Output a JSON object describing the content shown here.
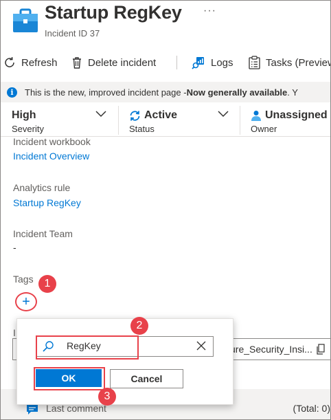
{
  "header": {
    "title": "Startup RegKey",
    "more": "···",
    "subtitle": "Incident ID 37"
  },
  "toolbar": {
    "refresh": "Refresh",
    "delete": "Delete incident",
    "logs": "Logs",
    "tasks": "Tasks (Preview"
  },
  "banner": {
    "text": "This is the new, improved incident page - ",
    "bold": "Now generally available",
    "tail": ". Y"
  },
  "status": {
    "severity_value": "High",
    "severity_label": "Severity",
    "status_value": "Active",
    "status_label": "Status",
    "owner_value": "Unassigned",
    "owner_label": "Owner"
  },
  "details": {
    "workbook_label": "Incident workbook",
    "workbook_link": "Incident Overview",
    "rule_label": "Analytics rule",
    "rule_link": "Startup RegKey",
    "team_label": "Incident Team",
    "team_value": "-",
    "tags_label": "Tags",
    "hidden_label_fragment": "I",
    "workspace_fragment": "ure_Security_Insi..."
  },
  "last_comment": {
    "label": "Last comment",
    "total": "(Total: 0)"
  },
  "tag_popup": {
    "input_value": "RegKey",
    "ok_label": "OK",
    "cancel_label": "Cancel"
  },
  "steps": {
    "one": "1",
    "two": "2",
    "three": "3"
  },
  "colors": {
    "accent": "#0078d4",
    "annotation": "#e8414a"
  }
}
